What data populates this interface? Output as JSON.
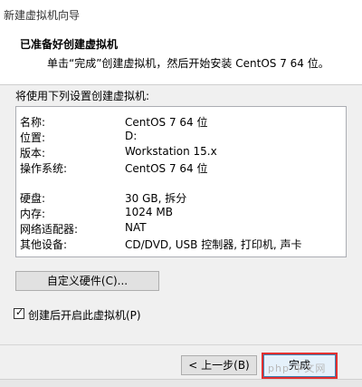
{
  "window": {
    "title": "新建虚拟机向导"
  },
  "header": {
    "title": "已准备好创建虚拟机",
    "subtitle": "单击“完成”创建虚拟机，然后开始安装 CentOS 7 64 位。"
  },
  "section_label": "将使用下列设置创建虚拟机:",
  "summary": {
    "rows": [
      {
        "key": "名称:",
        "value": "CentOS 7 64 位"
      },
      {
        "key": "位置:",
        "value": "D:"
      },
      {
        "key": "版本:",
        "value": "Workstation 15.x"
      },
      {
        "key": "操作系统:",
        "value": "CentOS 7 64 位"
      },
      {
        "key": "硬盘:",
        "value": "30 GB, 拆分"
      },
      {
        "key": "内存:",
        "value": "1024 MB"
      },
      {
        "key": "网络适配器:",
        "value": "NAT"
      },
      {
        "key": "其他设备:",
        "value": "CD/DVD, USB 控制器, 打印机, 声卡"
      }
    ]
  },
  "customize_button": "自定义硬件(C)...",
  "power_on_checkbox": {
    "label": "创建后开启此虚拟机(P)",
    "checked": true,
    "mark": "✓"
  },
  "buttons": {
    "back": "< 上一步(B)",
    "finish": "完成"
  },
  "watermark": "php 中文网"
}
